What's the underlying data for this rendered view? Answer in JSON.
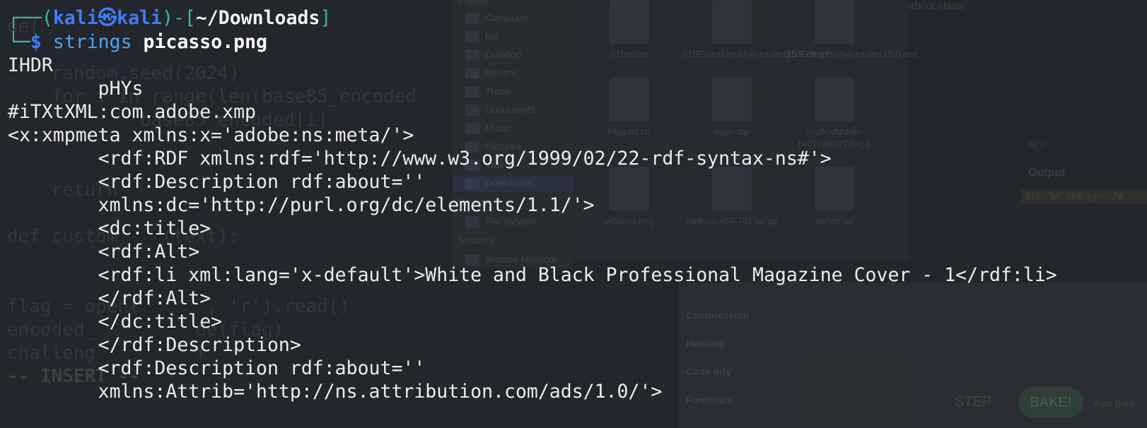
{
  "terminal": {
    "prompt": {
      "corner_top": "┌──(",
      "user": "kali",
      "at_symbol": "㉿",
      "host": "kali",
      "mid": ")-[",
      "cwd": "~/Downloads",
      "close": "]",
      "corner_bottom": "└─",
      "dollar": "$",
      "command": "strings",
      "argument": "picasso.png"
    },
    "output_lines": [
      "IHDR",
      "        pHYs",
      "#iTXtXML:com.adobe.xmp",
      "<x:xmpmeta xmlns:x='adobe:ns:meta/'>",
      "        <rdf:RDF xmlns:rdf='http://www.w3.org/1999/02/22-rdf-syntax-ns#'>",
      "        <rdf:Description rdf:about=''",
      "        xmlns:dc='http://purl.org/dc/elements/1.1/'>",
      "        <dc:title>",
      "        <rdf:Alt>",
      "        <rdf:li xml:lang='x-default'>White and Black Professional Magazine Cover - 1</rdf:li>",
      "        </rdf:Alt>",
      "        </dc:title>",
      "        </rdf:Description>",
      "        <rdf:Description rdf:about=''",
      "        xmlns:Attrib='http://ns.attribution.com/ads/1.0/'>"
    ]
  },
  "background_editor": {
    "lines": [
      "",
      "de(",
      "",
      "    random.seed(2024)",
      "    for i in range(len(base85_encoded",
      "            base85_encoded[i]",
      "",
      "",
      "    return",
      "",
      "def custom_   (text):",
      "",
      "",
      "flag = open(      , 'r').read()",
      "encoded_         de(flag)",
      "challeng         f",
      "-- INSERT --"
    ]
  },
  "background_file_manager": {
    "sidebar_heading": "Places",
    "sidebar_items": [
      "Computer",
      "kali",
      "Desktop",
      "Recent",
      "Trash",
      "Documents",
      "Music",
      "Pictures",
      "Videos",
      "Downloads"
    ],
    "sidebar_section_devices": "Devices",
    "sidebar_filesystem": "File System",
    "sidebar_section_network": "Network",
    "sidebar_browse_network": "Browse Network",
    "files": [
      {
        "name": "010editor"
      },
      {
        "name": "010EditorLinux64Installer15.0.tar.gz"
      },
      {
        "name": "010EditorWin64Installer15.0.exe"
      },
      {
        "name": "Flag.txt.txt"
      },
      {
        "name": "login.zip"
      },
      {
        "name": "mo8cxfgld4b-tw07cwk9z78vq.p"
      },
      {
        "name": "picasso.png"
      },
      {
        "name": "rarlinux-x64-701.tar.gz"
      },
      {
        "name": "server.py"
      }
    ],
    "top_right_text": "about chats"
  },
  "background_cyberchef": {
    "categories": [
      "Compression",
      "Hashing",
      "Code tidy",
      "Forensics"
    ],
    "step_label": "STEP",
    "bake_label": "BAKE!",
    "auto_bake_label": "Auto Bake",
    "output_heading": "Output",
    "output_meta": "38   1",
    "output_value": "8lI-`bP`O6R`\\=~:-7W"
  }
}
